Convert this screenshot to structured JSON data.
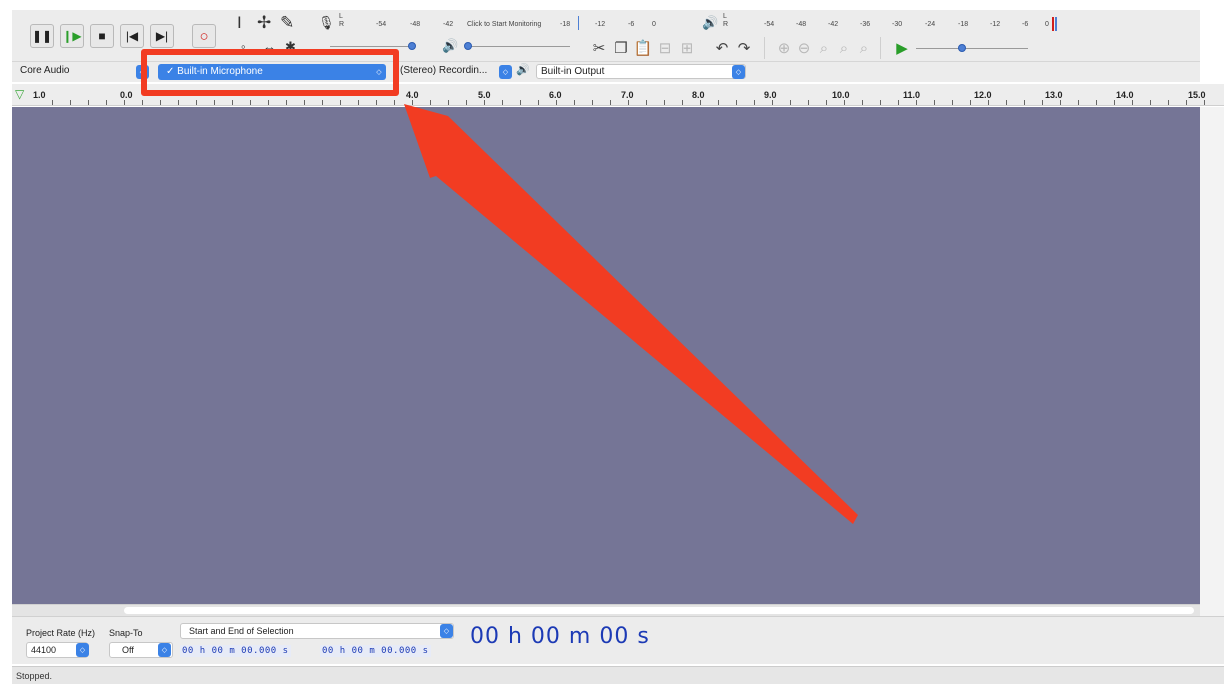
{
  "meter": {
    "record_ticks": [
      "-54",
      "-48",
      "-42",
      "-18",
      "-12",
      "-6",
      "0"
    ],
    "play_ticks": [
      "-54",
      "-48",
      "-42",
      "-36",
      "-30",
      "-24",
      "-18",
      "-12",
      "-6",
      "0"
    ],
    "monitor_label": "Click to Start Monitoring",
    "left_channel": "L",
    "right_channel": "R"
  },
  "device": {
    "host": "Core Audio",
    "recording_device": "✓ Built-in Microphone",
    "recording_channels": "(Stereo) Recordin...",
    "playback_device": "Built-in Output"
  },
  "ruler": {
    "labels": [
      "1.0",
      "0.0",
      "4.0",
      "5.0",
      "6.0",
      "7.0",
      "8.0",
      "9.0",
      "10.0",
      "11.0",
      "12.0",
      "13.0",
      "14.0",
      "15.0"
    ]
  },
  "selection": {
    "project_rate_label": "Project Rate (Hz)",
    "project_rate_value": "44100",
    "snap_label": "Snap-To",
    "snap_value": "Off",
    "mode": "Start and End of Selection",
    "start_time": "00 h 00 m 00.000 s",
    "end_time": "00 h 00 m 00.000 s",
    "audio_position": "00 h 00 m 00 s"
  },
  "status": {
    "text": "Stopped."
  },
  "colors": {
    "track_background": "#757596",
    "annotation_red": "#f23c22",
    "accent_blue": "#3b82e6",
    "time_digits": "#1c3ab5"
  }
}
